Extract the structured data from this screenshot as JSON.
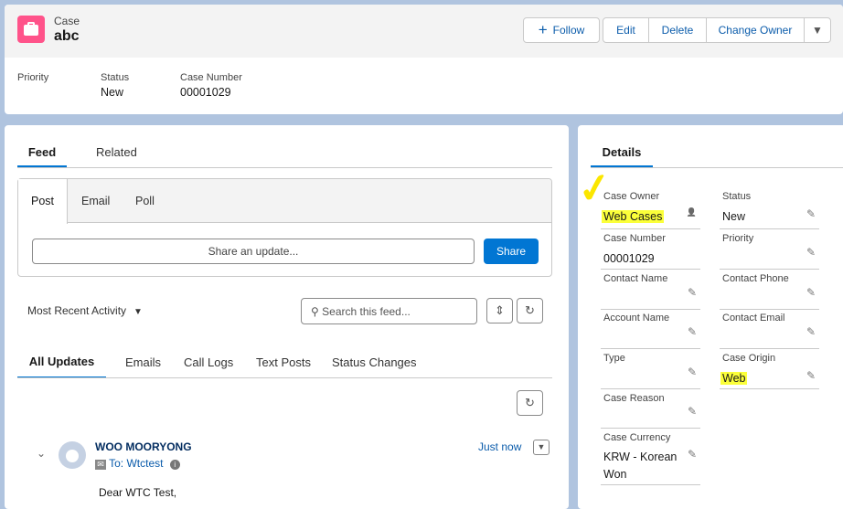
{
  "header": {
    "object_label": "Case",
    "title": "abc",
    "icon": "briefcase-icon",
    "icon_color": "#ff538a",
    "buttons": {
      "follow": "Follow",
      "edit": "Edit",
      "delete": "Delete",
      "change_owner": "Change Owner"
    },
    "highlights": [
      {
        "label": "Priority",
        "value": ""
      },
      {
        "label": "Status",
        "value": "New"
      },
      {
        "label": "Case Number",
        "value": "00001029"
      }
    ]
  },
  "feed": {
    "tabs": [
      "Feed",
      "Related"
    ],
    "publisher_tabs": [
      "Post",
      "Email",
      "Poll"
    ],
    "share_placeholder": "Share an update...",
    "share_button": "Share",
    "sort": "Most Recent Activity",
    "search_placeholder": "Search this feed...",
    "filter_tabs": [
      "All Updates",
      "Emails",
      "Call Logs",
      "Text Posts",
      "Status Changes"
    ],
    "item": {
      "author": "WOO MOORYONG",
      "to": "To: Wtctest",
      "time": "Just now",
      "body": "Dear WTC Test,"
    }
  },
  "details": {
    "tab": "Details",
    "left": [
      {
        "label": "Case Owner",
        "value": "Web Cases"
      },
      {
        "label": "Case Number",
        "value": "00001029"
      },
      {
        "label": "Contact Name",
        "value": ""
      },
      {
        "label": "Account Name",
        "value": ""
      },
      {
        "label": "Type",
        "value": ""
      },
      {
        "label": "Case Reason",
        "value": ""
      },
      {
        "label": "Case Currency",
        "value": "KRW - Korean Won"
      }
    ],
    "right": [
      {
        "label": "Status",
        "value": "New"
      },
      {
        "label": "Priority",
        "value": ""
      },
      {
        "label": "Contact Phone",
        "value": ""
      },
      {
        "label": "Contact Email",
        "value": ""
      },
      {
        "label": "Case Origin",
        "value": "Web"
      }
    ],
    "highlight_color": "#fbff3a"
  }
}
